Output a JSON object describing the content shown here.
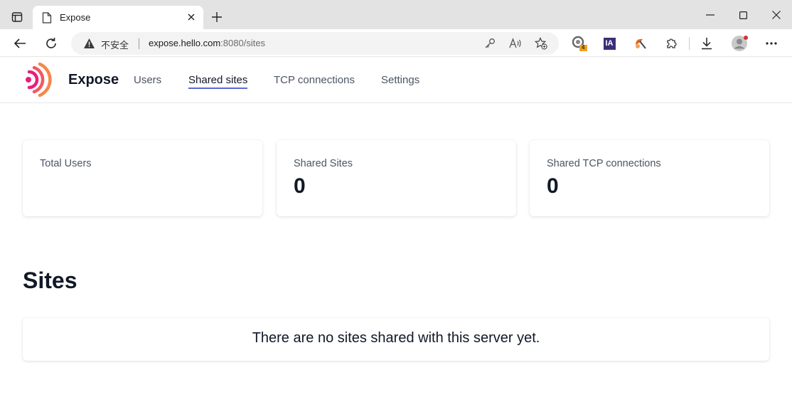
{
  "browser": {
    "tab_title": "Expose",
    "security_label": "不安全",
    "url_host": "expose.hello.com",
    "url_rest": ":8080/sites",
    "extensions": [
      {
        "name": "extension-badge",
        "badge": "4"
      },
      {
        "name": "ia-extension",
        "label": "IA"
      }
    ]
  },
  "app": {
    "brand": "Expose",
    "nav": [
      "Users",
      "Shared sites",
      "TCP connections",
      "Settings"
    ],
    "active_nav": "Shared sites",
    "logo_colors": [
      "#ec1c7e",
      "#f05a5f",
      "#f5874a"
    ]
  },
  "stats": [
    {
      "label": "Total Users",
      "value": ""
    },
    {
      "label": "Shared Sites",
      "value": "0"
    },
    {
      "label": "Shared TCP connections",
      "value": "0"
    }
  ],
  "sites": {
    "heading": "Sites",
    "empty_message": "There are no sites shared with this server yet."
  },
  "colors": {
    "accent": "#5a67d8",
    "text_primary": "#111827",
    "text_secondary": "#4b5563"
  }
}
